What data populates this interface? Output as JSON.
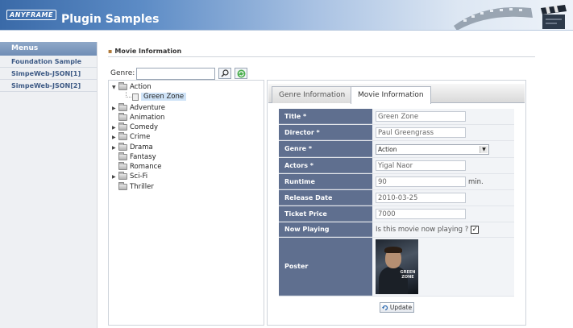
{
  "header": {
    "logo": "ANYFRAME",
    "title": "Plugin Samples"
  },
  "sidebar": {
    "header": "Menus",
    "items": [
      {
        "label": "Foundation Sample"
      },
      {
        "label": "SimpeWeb-JSON[1]"
      },
      {
        "label": "SimpeWeb-JSON[2]"
      }
    ]
  },
  "main": {
    "section_title": "Movie Information",
    "genre_label": "Genre:",
    "genre_value": ""
  },
  "tree": {
    "items": [
      {
        "label": "Action",
        "expanded": true
      },
      {
        "label": "Green Zone",
        "selected": true
      },
      {
        "label": "Adventure"
      },
      {
        "label": "Animation"
      },
      {
        "label": "Comedy"
      },
      {
        "label": "Crime"
      },
      {
        "label": "Drama"
      },
      {
        "label": "Fantasy"
      },
      {
        "label": "Romance"
      },
      {
        "label": "Sci-Fi"
      },
      {
        "label": "Thriller"
      }
    ]
  },
  "tabs": [
    {
      "label": "Genre Information",
      "active": false
    },
    {
      "label": "Movie Information",
      "active": true
    }
  ],
  "form": {
    "title_label": "Title *",
    "title_value": "Green Zone",
    "director_label": "Director *",
    "director_value": "Paul Greengrass",
    "genre_label": "Genre *",
    "genre_value": "Action",
    "actors_label": "Actors *",
    "actors_value": "Yigal Naor",
    "runtime_label": "Runtime",
    "runtime_value": "90",
    "runtime_unit": "min.",
    "release_label": "Release Date",
    "release_value": "2010-03-25",
    "price_label": "Ticket Price",
    "price_value": "7000",
    "playing_label": "Now Playing",
    "playing_question": "Is this movie now playing ?",
    "playing_checked": true,
    "poster_label": "Poster",
    "poster_text": "GREEN ZONE"
  },
  "update_button": "Update",
  "colors": {
    "header_accent": "#3a6aa8",
    "form_label_bg": "#5f6f8f",
    "sidebar_bg": "#eef0f3",
    "selected_bg": "#cfe3f7"
  }
}
